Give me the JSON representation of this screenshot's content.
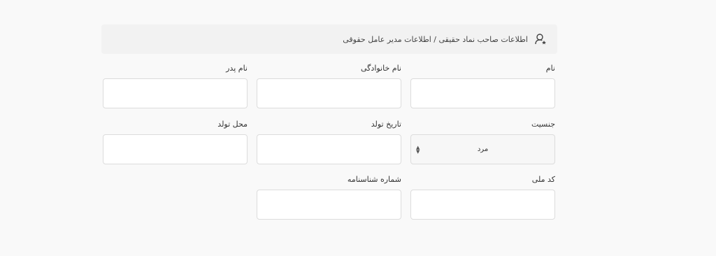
{
  "header": {
    "title": "اطلاعات صاحب نماد حقیقی / اطلاعات مدیر عامل حقوقی",
    "icon": "user-star-icon"
  },
  "fields": {
    "first_name": {
      "label": "نام",
      "value": ""
    },
    "last_name": {
      "label": "نام خانوادگی",
      "value": ""
    },
    "father_name": {
      "label": "نام پدر",
      "value": ""
    },
    "gender": {
      "label": "جنسیت",
      "selected": "مرد"
    },
    "birth_date": {
      "label": "تاریخ تولد",
      "value": ""
    },
    "birth_place": {
      "label": "محل تولد",
      "value": ""
    },
    "national_code": {
      "label": "کد ملی",
      "value": ""
    },
    "id_number": {
      "label": "شماره شناسنامه",
      "value": ""
    }
  }
}
